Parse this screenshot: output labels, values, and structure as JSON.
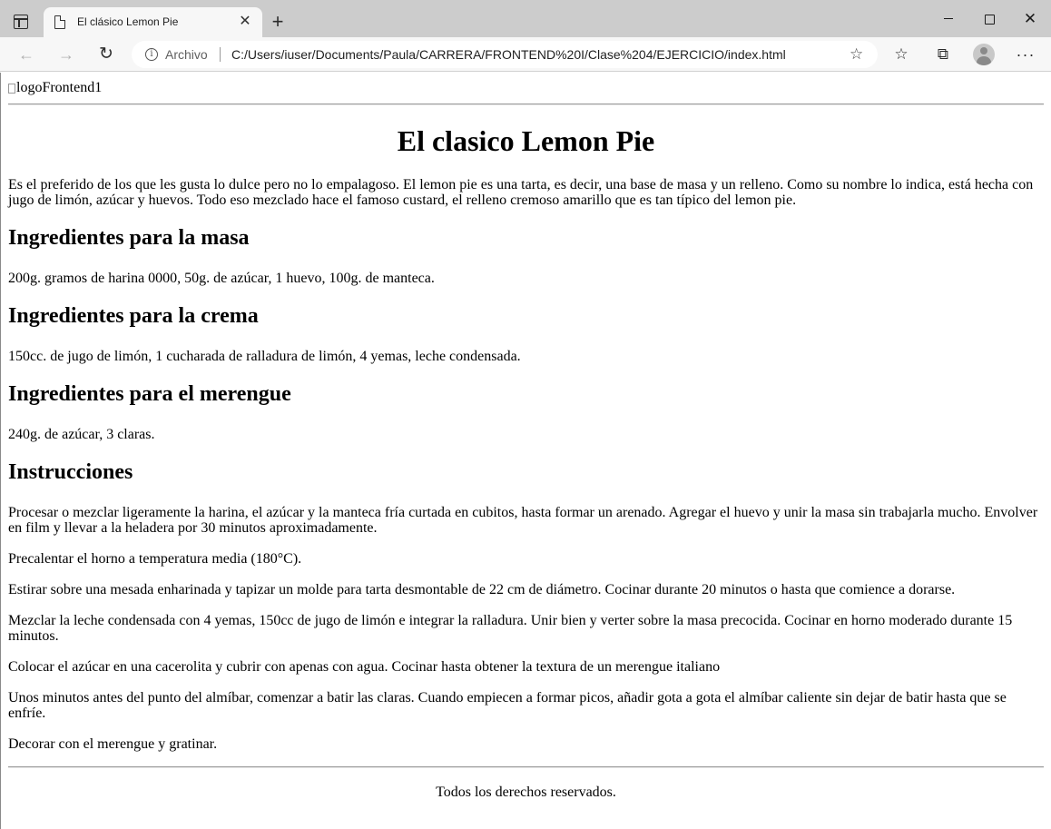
{
  "browser": {
    "tab": {
      "title": "El clásico Lemon Pie"
    },
    "address": {
      "scheme_label": "Archivo",
      "url": "C:/Users/iuser/Documents/Paula/CARRERA/FRONTEND%20I/Clase%204/EJERCICIO/index.html"
    },
    "icons": {
      "tab_actions": "tab-actions-icon",
      "page": "page-icon",
      "close": "close-icon",
      "new_tab": "plus-icon",
      "back": "arrow-left-icon",
      "forward": "arrow-right-icon",
      "reload": "reload-icon",
      "info": "info-icon",
      "add_favorite": "star-plus-icon",
      "favorites": "favorites-icon",
      "collections": "collections-icon",
      "profile": "profile-icon",
      "menu": "more-icon"
    }
  },
  "page": {
    "logo_alt": "logoFrontend1",
    "title": "El clasico Lemon Pie",
    "intro": "Es el preferido de los que les gusta lo dulce pero no lo empalagoso. El lemon pie es una tarta, es decir, una base de masa y un relleno. Como su nombre lo indica, está hecha con jugo de limón, azúcar y huevos. Todo eso mezclado hace el famoso custard, el relleno cremoso amarillo que es tan típico del lemon pie.",
    "sections": [
      {
        "heading": "Ingredientes para la masa",
        "text": "200g. gramos de harina 0000, 50g. de azúcar, 1 huevo, 100g. de manteca."
      },
      {
        "heading": "Ingredientes para la crema",
        "text": "150cc. de jugo de limón, 1 cucharada de ralladura de limón, 4 yemas, leche condensada."
      },
      {
        "heading": "Ingredientes para el merengue",
        "text": "240g. de azúcar, 3 claras."
      }
    ],
    "instructions": {
      "heading": "Instrucciones",
      "steps": [
        "Procesar o mezclar ligeramente la harina, el azúcar y la manteca fría curtada en cubitos, hasta formar un arenado. Agregar el huevo y unir la masa sin trabajarla mucho. Envolver en film y llevar a la heladera por 30 minutos aproximadamente.",
        "Precalentar el horno a temperatura media (180°C).",
        "Estirar sobre una mesada enharinada y tapizar un molde para tarta desmontable de 22 cm de diámetro. Cocinar durante 20 minutos o hasta que comience a dorarse.",
        "Mezclar la leche condensada con 4 yemas, 150cc de jugo de limón e integrar la ralladura. Unir bien y verter sobre la masa precocida. Cocinar en horno moderado durante 15 minutos.",
        "Colocar el azúcar en una cacerolita y cubrir con apenas con agua. Cocinar hasta obtener la textura de un merengue italiano",
        "Unos minutos antes del punto del almíbar, comenzar a batir las claras. Cuando empiecen a formar picos, añadir gota a gota el almíbar caliente sin dejar de batir hasta que se enfríe.",
        "Decorar con el merengue y gratinar."
      ]
    },
    "footer": "Todos los derechos reservados."
  }
}
